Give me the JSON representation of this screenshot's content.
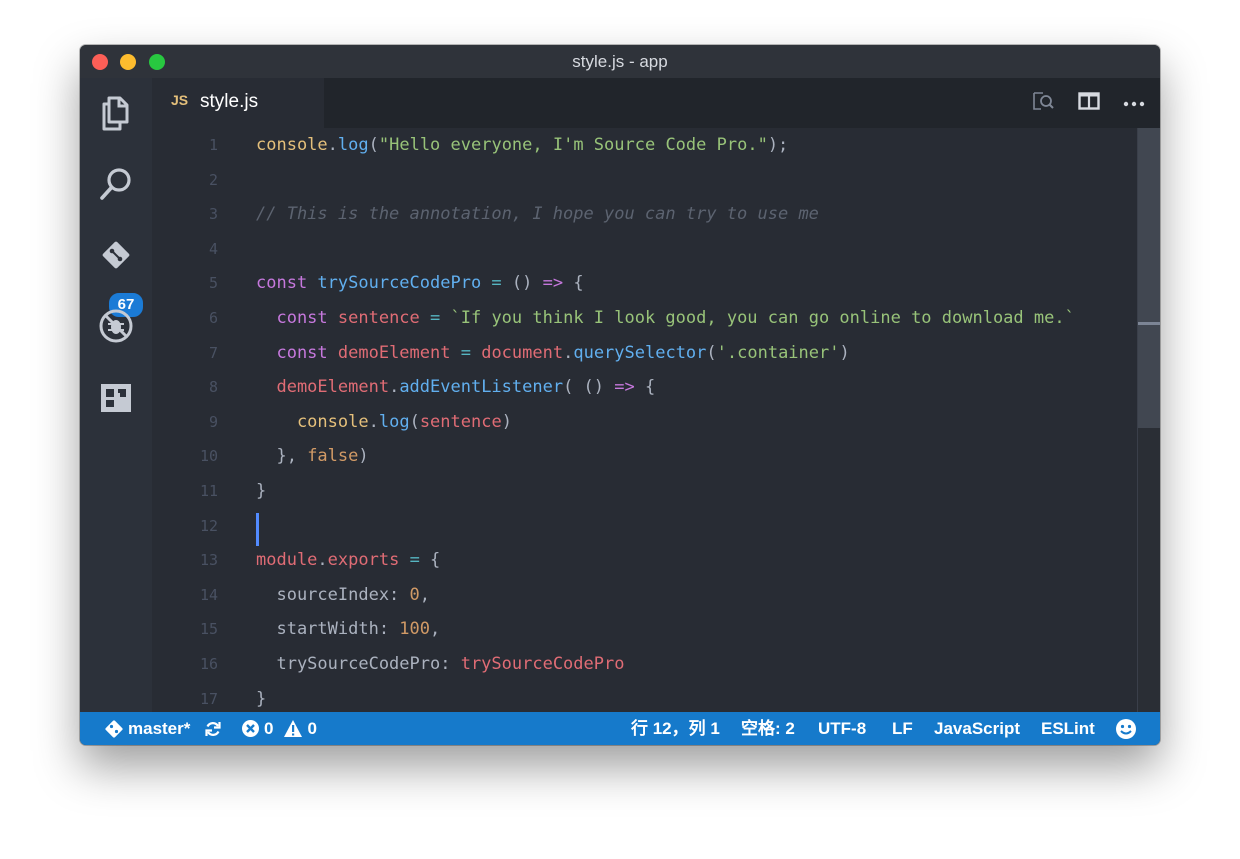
{
  "window": {
    "title": "style.js - app"
  },
  "activity_bar": {
    "items": [
      {
        "name": "explorer",
        "icon": "files-icon"
      },
      {
        "name": "search",
        "icon": "search-icon"
      },
      {
        "name": "source-control",
        "icon": "git-icon",
        "badge": "67"
      },
      {
        "name": "debug",
        "icon": "bug-icon"
      },
      {
        "name": "extensions",
        "icon": "extensions-icon"
      }
    ]
  },
  "tabs": [
    {
      "icon_text": "JS",
      "label": "style.js",
      "active": true
    }
  ],
  "toolbar": {
    "actions": [
      "open-preview-icon",
      "split-editor-icon",
      "more-actions-icon"
    ]
  },
  "editor": {
    "lines": [
      {
        "num": "1",
        "tokens": [
          {
            "t": "console",
            "c": "#e5c07b"
          },
          {
            "t": ".",
            "c": "#abb2bf"
          },
          {
            "t": "log",
            "c": "#61afef"
          },
          {
            "t": "(",
            "c": "#abb2bf"
          },
          {
            "t": "\"Hello everyone, I'm Source Code Pro.\"",
            "c": "#98c379"
          },
          {
            "t": ");",
            "c": "#abb2bf"
          }
        ]
      },
      {
        "num": "2",
        "tokens": []
      },
      {
        "num": "3",
        "tokens": [
          {
            "t": "// This is the annotation, I hope you can try to use me",
            "c": "#5c6370",
            "i": true
          }
        ]
      },
      {
        "num": "4",
        "tokens": []
      },
      {
        "num": "5",
        "tokens": [
          {
            "t": "const ",
            "c": "#c678dd"
          },
          {
            "t": "trySourceCodePro",
            "c": "#61afef"
          },
          {
            "t": " = ",
            "c": "#56b6c2"
          },
          {
            "t": "() ",
            "c": "#abb2bf"
          },
          {
            "t": "=>",
            "c": "#c678dd"
          },
          {
            "t": " {",
            "c": "#abb2bf"
          }
        ]
      },
      {
        "num": "6",
        "tokens": [
          {
            "t": "  const ",
            "c": "#c678dd"
          },
          {
            "t": "sentence",
            "c": "#e06c75"
          },
          {
            "t": " = ",
            "c": "#56b6c2"
          },
          {
            "t": "`If you think I look good, you can go online to download me.`",
            "c": "#98c379"
          }
        ]
      },
      {
        "num": "7",
        "tokens": [
          {
            "t": "  const ",
            "c": "#c678dd"
          },
          {
            "t": "demoElement",
            "c": "#e06c75"
          },
          {
            "t": " = ",
            "c": "#56b6c2"
          },
          {
            "t": "document",
            "c": "#e06c75"
          },
          {
            "t": ".",
            "c": "#abb2bf"
          },
          {
            "t": "querySelector",
            "c": "#61afef"
          },
          {
            "t": "(",
            "c": "#abb2bf"
          },
          {
            "t": "'.container'",
            "c": "#98c379"
          },
          {
            "t": ")",
            "c": "#abb2bf"
          }
        ]
      },
      {
        "num": "8",
        "tokens": [
          {
            "t": "  demoElement",
            "c": "#e06c75"
          },
          {
            "t": ".",
            "c": "#abb2bf"
          },
          {
            "t": "addEventListener",
            "c": "#61afef"
          },
          {
            "t": "( () ",
            "c": "#abb2bf"
          },
          {
            "t": "=>",
            "c": "#c678dd"
          },
          {
            "t": " {",
            "c": "#abb2bf"
          }
        ]
      },
      {
        "num": "9",
        "tokens": [
          {
            "t": "    console",
            "c": "#e5c07b"
          },
          {
            "t": ".",
            "c": "#abb2bf"
          },
          {
            "t": "log",
            "c": "#61afef"
          },
          {
            "t": "(",
            "c": "#abb2bf"
          },
          {
            "t": "sentence",
            "c": "#e06c75"
          },
          {
            "t": ")",
            "c": "#abb2bf"
          }
        ]
      },
      {
        "num": "10",
        "tokens": [
          {
            "t": "  }, ",
            "c": "#abb2bf"
          },
          {
            "t": "false",
            "c": "#d19a66"
          },
          {
            "t": ")",
            "c": "#abb2bf"
          }
        ]
      },
      {
        "num": "11",
        "tokens": [
          {
            "t": "}",
            "c": "#abb2bf"
          }
        ]
      },
      {
        "num": "12",
        "tokens": [],
        "cursor": true
      },
      {
        "num": "13",
        "tokens": [
          {
            "t": "module",
            "c": "#e06c75"
          },
          {
            "t": ".",
            "c": "#abb2bf"
          },
          {
            "t": "exports",
            "c": "#e06c75"
          },
          {
            "t": " = ",
            "c": "#56b6c2"
          },
          {
            "t": "{",
            "c": "#abb2bf"
          }
        ]
      },
      {
        "num": "14",
        "tokens": [
          {
            "t": "  sourceIndex: ",
            "c": "#abb2bf"
          },
          {
            "t": "0",
            "c": "#d19a66"
          },
          {
            "t": ",",
            "c": "#abb2bf"
          }
        ]
      },
      {
        "num": "15",
        "tokens": [
          {
            "t": "  startWidth: ",
            "c": "#abb2bf"
          },
          {
            "t": "100",
            "c": "#d19a66"
          },
          {
            "t": ",",
            "c": "#abb2bf"
          }
        ]
      },
      {
        "num": "16",
        "tokens": [
          {
            "t": "  trySourceCodePro: ",
            "c": "#abb2bf"
          },
          {
            "t": "trySourceCodePro",
            "c": "#e06c75"
          }
        ]
      },
      {
        "num": "17",
        "tokens": [
          {
            "t": "}",
            "c": "#abb2bf"
          }
        ]
      }
    ]
  },
  "status": {
    "branch": "master*",
    "errors": "0",
    "warnings": "0",
    "position": "行 12，列 1",
    "spaces": "空格: 2",
    "encoding": "UTF-8",
    "eol": "LF",
    "language": "JavaScript",
    "linter": "ESLint"
  },
  "colors": {
    "background": "#282c34",
    "activity_bar": "#2c313a",
    "status_bar": "#167acb",
    "accent_badge": "#1b7bd6"
  }
}
